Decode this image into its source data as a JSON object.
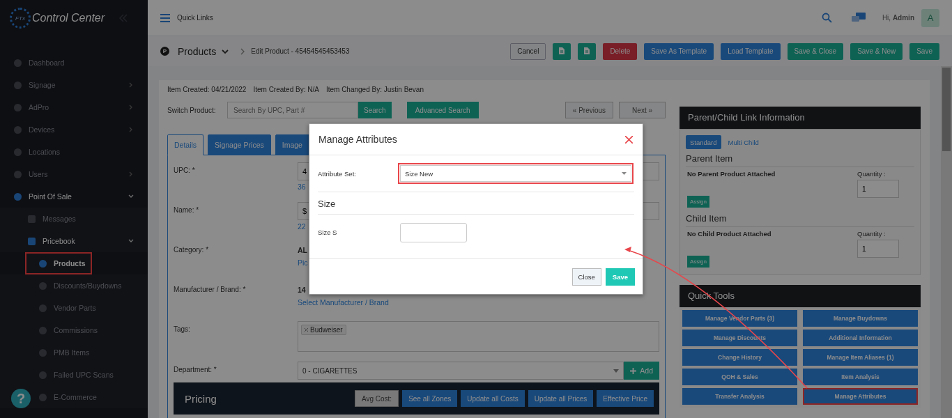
{
  "sidebar": {
    "logo_badge": "FTx",
    "logo_title": "Control Center",
    "help_label": "?",
    "items": [
      {
        "label": "Dashboard",
        "selected": false,
        "highlighted": false
      },
      {
        "label": "Signage",
        "selected": false,
        "highlighted": false,
        "expanded": false
      },
      {
        "label": "AdPro",
        "selected": false,
        "highlighted": false,
        "expanded": false
      },
      {
        "label": "Devices",
        "selected": false,
        "highlighted": false,
        "expanded": false
      },
      {
        "label": "Locations",
        "selected": false,
        "highlighted": false
      },
      {
        "label": "Users",
        "selected": false,
        "highlighted": false,
        "expanded": false
      },
      {
        "label": "Point Of Sale",
        "selected": false,
        "highlighted": false,
        "expanded": true,
        "children": [
          {
            "label": "Messages",
            "selected": false,
            "highlighted": false
          },
          {
            "label": "Pricebook",
            "selected": false,
            "highlighted": false,
            "expanded": true,
            "children": [
              {
                "label": "Products",
                "selected": true,
                "highlighted": true
              },
              {
                "label": "Discounts/Buydowns",
                "selected": false,
                "highlighted": false
              },
              {
                "label": "Vendor Parts",
                "selected": false,
                "highlighted": false
              },
              {
                "label": "Commissions",
                "selected": false,
                "highlighted": false
              },
              {
                "label": "PMB Items",
                "selected": false,
                "highlighted": false
              },
              {
                "label": "Failed UPC Scans",
                "selected": false,
                "highlighted": false
              },
              {
                "label": "E-Commerce",
                "selected": false,
                "highlighted": false
              }
            ]
          }
        ]
      }
    ]
  },
  "topbar": {
    "quick_links": "Quick Links",
    "greeting": "Hi, **Admin**",
    "avatar": "A"
  },
  "page_header": {
    "icon_letter": "P",
    "title": "Products",
    "breadcrumb": "Edit Product - 45454545453453",
    "buttons": [
      {
        "kind": "default",
        "label": "Cancel"
      },
      {
        "kind": "icon"
      },
      {
        "kind": "icon"
      },
      {
        "kind": "danger",
        "label": "Delete"
      },
      {
        "kind": "primary",
        "label": "Save As Template"
      },
      {
        "kind": "primary",
        "label": "Load Template"
      },
      {
        "kind": "success",
        "label": "Save & Close"
      },
      {
        "kind": "success",
        "label": "Save & New"
      },
      {
        "kind": "success",
        "label": "Save"
      }
    ]
  },
  "meta": [
    "Item Created: 04/21/2022",
    "Item Created By: N/A",
    "Item Changed By: Justin Bevan"
  ],
  "switch_product": {
    "label": "Switch Product:",
    "placeholder": "Search By UPC, Part #",
    "search": "Search",
    "advanced": "Advanced Search",
    "previous": "« Previous",
    "next": "Next »"
  },
  "tabs": [
    {
      "label": "Details",
      "selected": true
    },
    {
      "label": "Signage Prices",
      "selected": false
    },
    {
      "label": "Image",
      "selected": false
    }
  ],
  "form": [
    {
      "kind": "input",
      "label": "UPC: *",
      "value": "4",
      "link": "36"
    },
    {
      "kind": "input",
      "label": "Name: *",
      "value": "$",
      "link": "22"
    },
    {
      "kind": "text",
      "label": "Category: *",
      "value": "AL",
      "link": "Pic"
    },
    {
      "kind": "text",
      "label": "Manufacturer / Brand: *",
      "value": "14",
      "link": "Select Manufacturer / Brand"
    },
    {
      "kind": "tags",
      "label": "Tags:",
      "tags": [
        "Budweiser"
      ]
    },
    {
      "kind": "select",
      "label": "Department: *",
      "value": "0 - CIGARETTES",
      "button": "Add"
    }
  ],
  "pricing": {
    "title": "Pricing",
    "avg_cost": "Avg Cost:",
    "buttons": [
      "See all Zones",
      "Update all Costs",
      "Update all Prices",
      "Effective Price"
    ]
  },
  "link_panel": {
    "title": "Parent/Child Link Information",
    "tabs": [
      {
        "label": "Standard",
        "selected": true
      },
      {
        "label": "Multi Child",
        "selected": false
      }
    ],
    "sections": [
      {
        "title": "Parent Item",
        "status": "No Parent Product Attached",
        "quantity_label": "Quantity :",
        "quantity": "1",
        "assign": "Assign"
      },
      {
        "title": "Child Item",
        "status": "No Child Product Attached",
        "quantity_label": "Quantity :",
        "quantity": "1",
        "assign": "Assign"
      }
    ]
  },
  "quick_tools": {
    "title": "Quick Tools",
    "buttons": [
      {
        "label": "Manage Vendor Parts (3)",
        "highlighted": false
      },
      {
        "label": "Manage Buydowns",
        "highlighted": false
      },
      {
        "label": "Manage Discounts",
        "highlighted": false
      },
      {
        "label": "Additional Information",
        "highlighted": false
      },
      {
        "label": "Change History",
        "highlighted": false
      },
      {
        "label": "Manage Item Aliases (1)",
        "highlighted": false
      },
      {
        "label": "QOH & Sales",
        "highlighted": false
      },
      {
        "label": "Item Analysis",
        "highlighted": false
      },
      {
        "label": "Transfer Analysis",
        "highlighted": false
      },
      {
        "label": "Manage Attributes",
        "highlighted": true
      }
    ]
  },
  "modal": {
    "title": "Manage Attributes",
    "attribute_label": "Attribute Set:",
    "attribute_value": "Size New",
    "attribute_highlighted": true,
    "section": "Size",
    "field_label": "Size S",
    "close": "Close",
    "save": "Save"
  }
}
